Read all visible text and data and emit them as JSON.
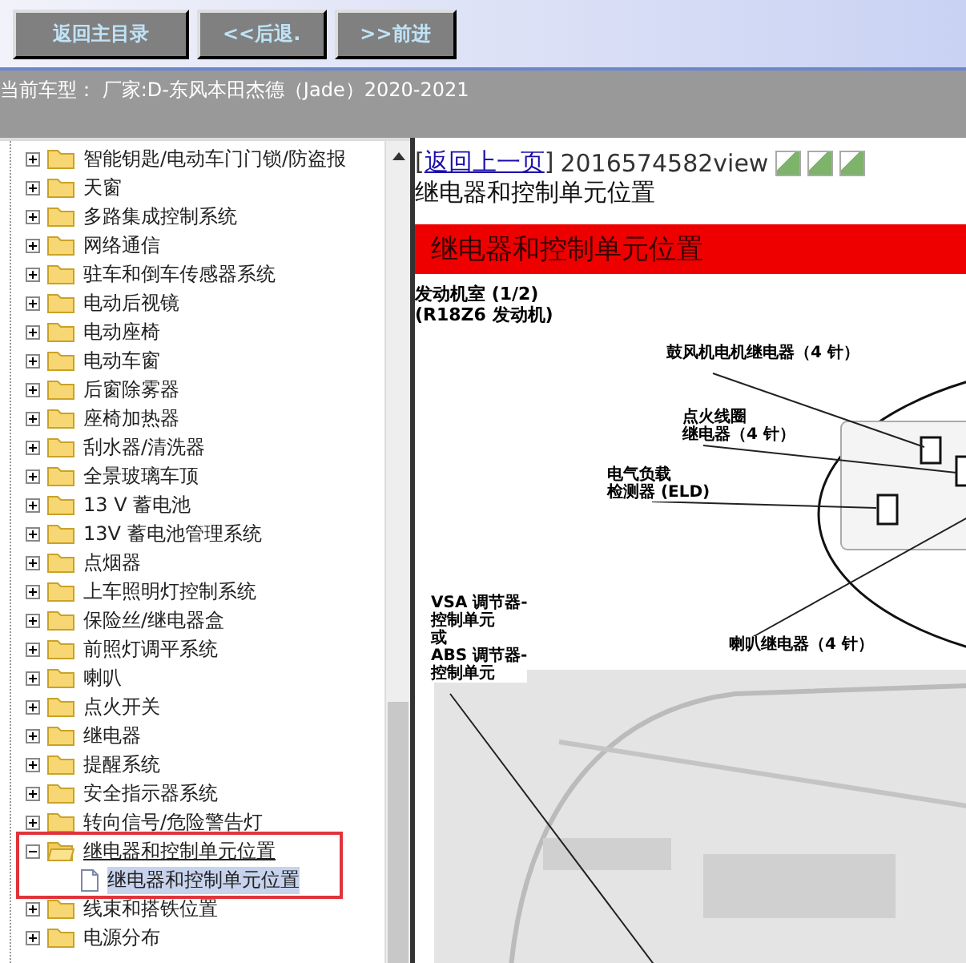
{
  "toolbar": {
    "buttons": [
      "返回主目录",
      "<<后退.",
      ">>前进"
    ]
  },
  "vehicle_bar": {
    "text": "当前车型：  厂家:D-东风本田杰德（Jade）2020-2021"
  },
  "tree": {
    "items": [
      {
        "label": "智能钥匙/电动车门门锁/防盗报",
        "expanded": false
      },
      {
        "label": "天窗",
        "expanded": false
      },
      {
        "label": "多路集成控制系统",
        "expanded": false
      },
      {
        "label": "网络通信",
        "expanded": false
      },
      {
        "label": "驻车和倒车传感器系统",
        "expanded": false
      },
      {
        "label": "电动后视镜",
        "expanded": false
      },
      {
        "label": "电动座椅",
        "expanded": false
      },
      {
        "label": "电动车窗",
        "expanded": false
      },
      {
        "label": "后窗除雾器",
        "expanded": false
      },
      {
        "label": "座椅加热器",
        "expanded": false
      },
      {
        "label": "刮水器/清洗器",
        "expanded": false
      },
      {
        "label": "全景玻璃车顶",
        "expanded": false
      },
      {
        "label": "13 V 蓄电池",
        "expanded": false
      },
      {
        "label": "13V 蓄电池管理系统",
        "expanded": false
      },
      {
        "label": "点烟器",
        "expanded": false
      },
      {
        "label": "上车照明灯控制系统",
        "expanded": false
      },
      {
        "label": "保险丝/继电器盒",
        "expanded": false
      },
      {
        "label": "前照灯调平系统",
        "expanded": false
      },
      {
        "label": "喇叭",
        "expanded": false
      },
      {
        "label": "点火开关",
        "expanded": false
      },
      {
        "label": "继电器",
        "expanded": false
      },
      {
        "label": "提醒系统",
        "expanded": false
      },
      {
        "label": "安全指示器系统",
        "expanded": false
      },
      {
        "label": "转向信号/危险警告灯",
        "expanded": false
      },
      {
        "label": "继电器和控制单元位置",
        "expanded": true,
        "children": [
          {
            "label": "继电器和控制单元位置",
            "selected": true
          }
        ]
      },
      {
        "label": "线束和搭铁位置",
        "expanded": false
      },
      {
        "label": "电源分布",
        "expanded": false
      }
    ]
  },
  "content": {
    "bracket_open": "[",
    "bracket_close": "]",
    "back_link": "返回上一页",
    "view_id": "2016574582view",
    "page_title": "继电器和控制单元位置",
    "banner": "继电器和控制单元位置",
    "section": "发动机室 (1/2)",
    "subsection": "(R18Z6 发动机)",
    "callouts": [
      {
        "kind": "blower",
        "lines": [
          "鼓风机电机继电器（4 针）"
        ]
      },
      {
        "kind": "coil",
        "lines": [
          "点火线圈",
          "继电器（4 针）"
        ]
      },
      {
        "kind": "eld",
        "lines": [
          "电气负载",
          "检测器 (ELD)"
        ]
      },
      {
        "kind": "vsa",
        "lines": [
          "VSA 调节器-",
          "控制单元",
          "或",
          "ABS 调节器-",
          "控制单元"
        ]
      },
      {
        "kind": "horn",
        "lines": [
          "喇叭继电器（4 针）"
        ]
      }
    ]
  }
}
